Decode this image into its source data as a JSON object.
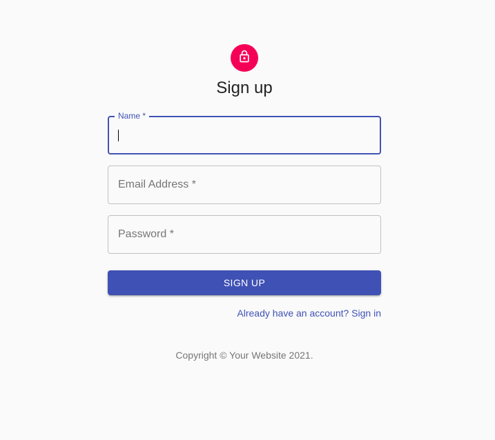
{
  "page": {
    "title": "Sign up"
  },
  "avatar": {
    "icon": "lock-outlined-icon",
    "color": "#f50057"
  },
  "form": {
    "name_field": {
      "label": "Name *",
      "value": "",
      "focused": true
    },
    "email_field": {
      "placeholder": "Email Address *",
      "value": ""
    },
    "password_field": {
      "placeholder": "Password *",
      "value": ""
    },
    "submit_label": "SIGN UP",
    "signin_link": "Already have an account? Sign in"
  },
  "footer": {
    "copyright": "Copyright © Your Website 2021."
  },
  "colors": {
    "primary": "#3f51b5",
    "secondary": "#f50057",
    "background": "#fafafa"
  }
}
